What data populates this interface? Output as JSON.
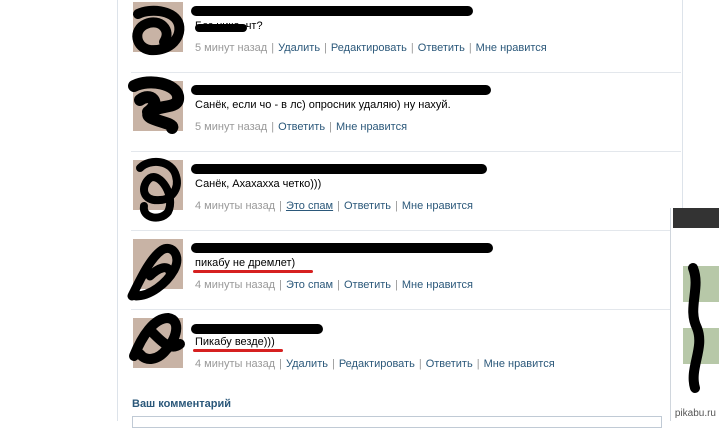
{
  "comments": [
    {
      "text": "Без ника, чт?",
      "time": "5 минут назад",
      "actions": [
        "Удалить",
        "Редактировать",
        "Ответить",
        "Мне нравится"
      ]
    },
    {
      "text": "Санёк, если чо - в лс) опросник удаляю) ну нахуй.",
      "time": "5 минут назад",
      "actions": [
        "Ответить",
        "Мне нравится"
      ]
    },
    {
      "text": "Санёк, Ахахахха четко)))",
      "time": "4 минуты назад",
      "actions": [
        "Это спам",
        "Ответить",
        "Мне нравится"
      ]
    },
    {
      "text": "пикабу не дремлет)",
      "time": "4 минуты назад",
      "actions": [
        "Это спам",
        "Ответить",
        "Мне нравится"
      ]
    },
    {
      "text": "Пикабу везде)))",
      "time": "4 минуты назад",
      "actions": [
        "Удалить",
        "Редактировать",
        "Ответить",
        "Мне нравится"
      ]
    }
  ],
  "your_comment_label": "Ваш комментарий",
  "watermark": "pikabu.ru",
  "colors": {
    "link": "#2b587a",
    "meta": "#999999",
    "redaction": "#000000",
    "underline": "#d62020"
  }
}
